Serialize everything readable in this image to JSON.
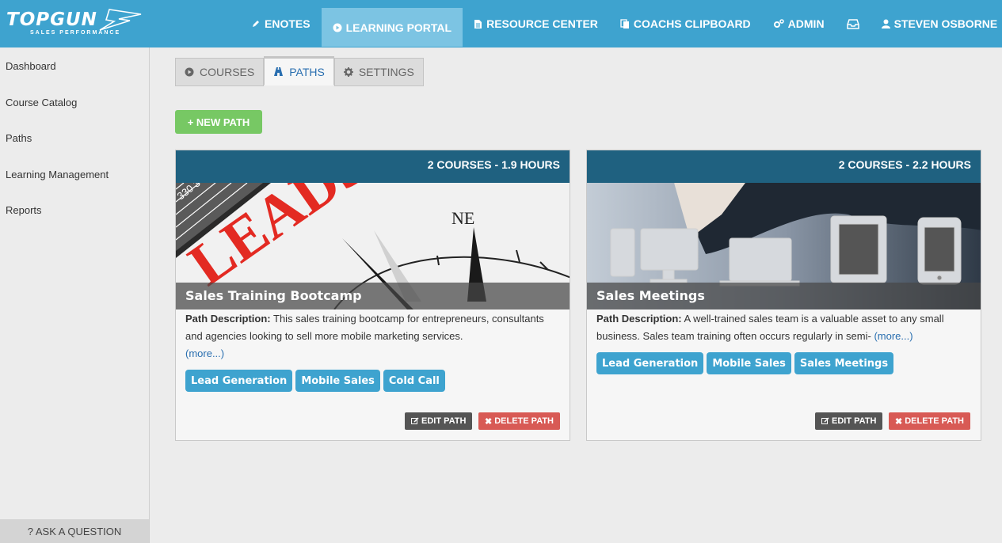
{
  "brand": {
    "name": "TOPGUN",
    "tagline": "SALES PERFORMANCE"
  },
  "nav": [
    {
      "icon": "pencil-icon",
      "label": "ENOTES"
    },
    {
      "icon": "play-circle-icon",
      "label": "LEARNING PORTAL",
      "active": true
    },
    {
      "icon": "document-icon",
      "label": "RESOURCE CENTER"
    },
    {
      "icon": "copy-icon",
      "label": "COACHS CLIPBOARD"
    },
    {
      "icon": "gears-icon",
      "label": "ADMIN"
    },
    {
      "icon": "inbox-icon",
      "label": ""
    },
    {
      "icon": "user-icon",
      "label": "STEVEN OSBORNE"
    }
  ],
  "sidebar": {
    "items": [
      "Dashboard",
      "Course Catalog",
      "Paths",
      "Learning Management",
      "Reports"
    ],
    "ask": "? ASK A QUESTION"
  },
  "tabs": [
    {
      "icon": "play-circle-icon",
      "label": "COURSES"
    },
    {
      "icon": "road-icon",
      "label": "PATHS",
      "active": true
    },
    {
      "icon": "gear-icon",
      "label": "SETTINGS"
    }
  ],
  "new_path_label": "+ NEW PATH",
  "cards": [
    {
      "meta": "2 COURSES - 1.9 HOURS",
      "title": "Sales Training Bootcamp",
      "desc_label": "Path Description:",
      "desc": "This sales training bootcamp for entrepreneurs, consultants and agencies looking to sell more mobile marketing services.",
      "more": "(more...)",
      "tags": [
        "Lead Generation",
        "Mobile Sales",
        "Cold Call"
      ],
      "edit": "EDIT PATH",
      "delete": "DELETE PATH",
      "image_text": [
        "LEADS",
        "NE"
      ]
    },
    {
      "meta": "2 COURSES - 2.2 HOURS",
      "title": "Sales Meetings",
      "desc_label": "Path Description:",
      "desc": "A well-trained sales team is a valuable asset to any small business. Sales team training often occurs regularly in semi-",
      "more": "(more...)",
      "tags": [
        "Lead Generation",
        "Mobile Sales",
        "Sales Meetings"
      ],
      "edit": "EDIT PATH",
      "delete": "DELETE PATH"
    }
  ],
  "colors": {
    "topbar": "#3ea3cf",
    "card_header": "#1f6180",
    "tag": "#3ea3cf",
    "new_path": "#77c864",
    "delete": "#d85a55"
  }
}
